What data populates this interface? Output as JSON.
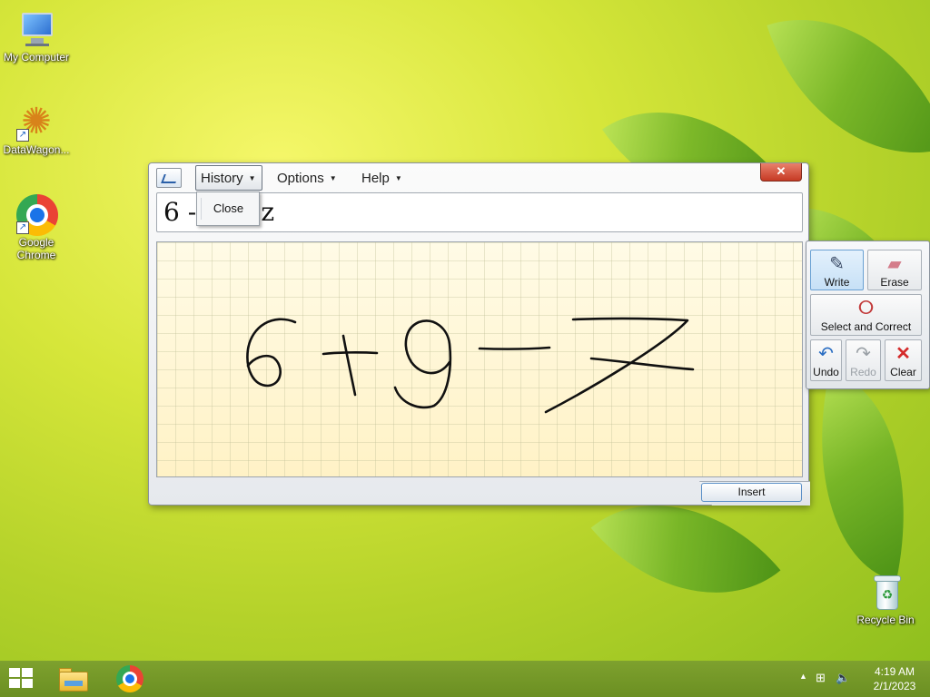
{
  "desktop": {
    "icons": [
      {
        "label": "My Computer",
        "icon": "computer-icon"
      },
      {
        "label": "DataWagon...",
        "icon": "datawagon-icon"
      },
      {
        "label": "Google Chrome",
        "icon": "chrome-icon"
      },
      {
        "label": "Recycle Bin",
        "icon": "recycle-bin-icon"
      }
    ]
  },
  "math_input_panel": {
    "menu": {
      "history": "History",
      "options": "Options",
      "help": "Help"
    },
    "history_menu": {
      "close": "Close"
    },
    "close_button": "✕",
    "preview_text": "6 -        z",
    "handwriting": "6+9-7",
    "insert_label": "Insert",
    "tools": {
      "write": "Write",
      "erase": "Erase",
      "select_correct": "Select and Correct",
      "undo": "Undo",
      "redo": "Redo",
      "clear": "Clear"
    },
    "active_tool": "write",
    "disabled_tools": [
      "redo"
    ]
  },
  "taskbar": {
    "pinned": [
      "file-explorer-icon",
      "chrome-icon"
    ],
    "tray": {
      "time": "4:19 AM",
      "date": "2/1/2023"
    }
  },
  "colors": {
    "ink": "#111111",
    "writing_area": "#fff8d5",
    "taskbar": "#6b8f22",
    "close_button": "#c63a24"
  }
}
